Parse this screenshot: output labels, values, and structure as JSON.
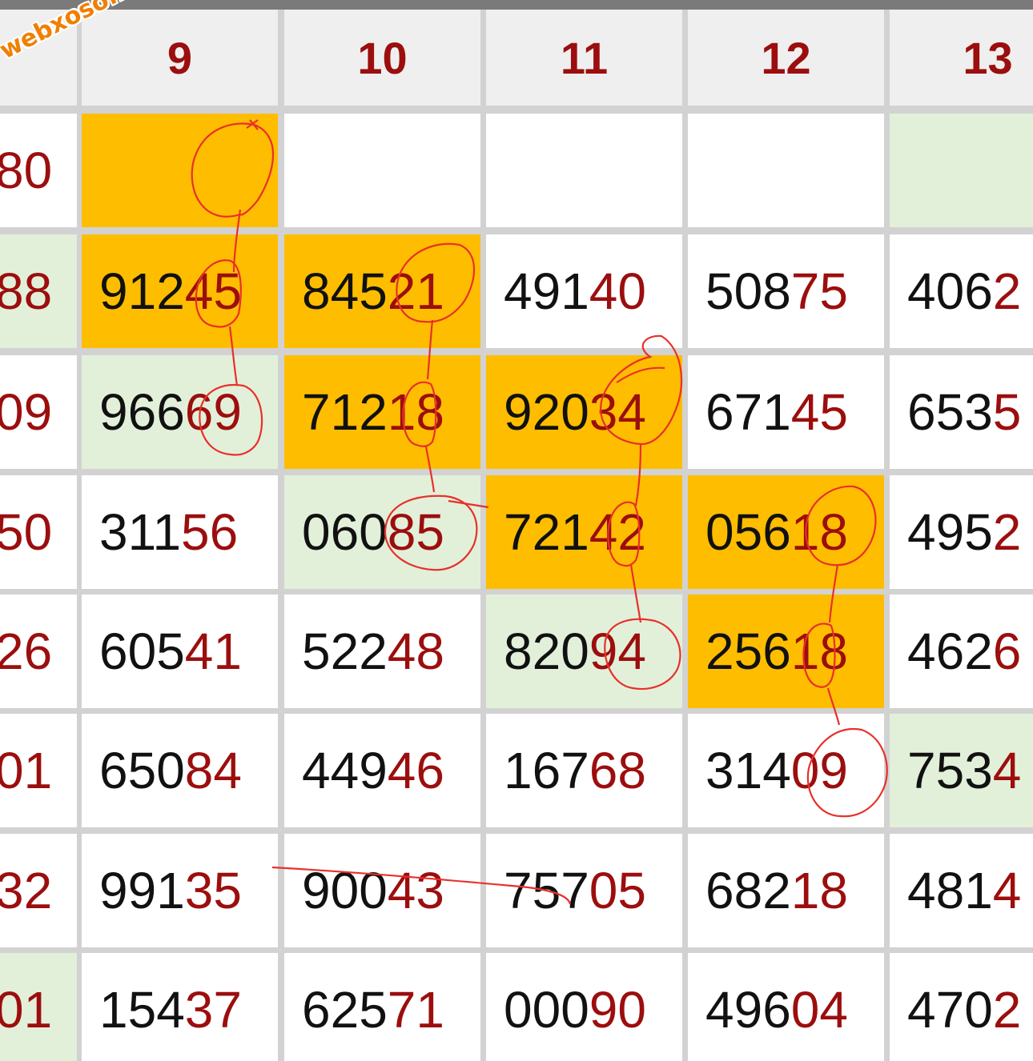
{
  "watermark": "webxoso.net",
  "columns": [
    "9",
    "10",
    "11",
    "12",
    "13"
  ],
  "rows": [
    {
      "label": "80",
      "cells": [
        {
          "digits": "",
          "tail": ""
        },
        {
          "digits": "",
          "tail": ""
        },
        {
          "digits": "",
          "tail": ""
        },
        {
          "digits": "",
          "tail": ""
        },
        {
          "digits": "",
          "tail": ""
        }
      ]
    },
    {
      "label": "88",
      "cells": [
        {
          "digits": "912",
          "tail": "45"
        },
        {
          "digits": "845",
          "tail": "21"
        },
        {
          "digits": "491",
          "tail": "40"
        },
        {
          "digits": "508",
          "tail": "75"
        },
        {
          "digits": "406",
          "tail": "2"
        }
      ]
    },
    {
      "label": "09",
      "cells": [
        {
          "digits": "966",
          "tail": "69"
        },
        {
          "digits": "712",
          "tail": "18"
        },
        {
          "digits": "920",
          "tail": "34"
        },
        {
          "digits": "671",
          "tail": "45"
        },
        {
          "digits": "653",
          "tail": "5"
        }
      ]
    },
    {
      "label": "50",
      "cells": [
        {
          "digits": "311",
          "tail": "56"
        },
        {
          "digits": "060",
          "tail": "85"
        },
        {
          "digits": "721",
          "tail": "42"
        },
        {
          "digits": "056",
          "tail": "18"
        },
        {
          "digits": "495",
          "tail": "2"
        }
      ]
    },
    {
      "label": "26",
      "cells": [
        {
          "digits": "605",
          "tail": "41"
        },
        {
          "digits": "522",
          "tail": "48"
        },
        {
          "digits": "820",
          "tail": "94"
        },
        {
          "digits": "256",
          "tail": "18"
        },
        {
          "digits": "462",
          "tail": "6"
        }
      ]
    },
    {
      "label": "01",
      "cells": [
        {
          "digits": "650",
          "tail": "84"
        },
        {
          "digits": "449",
          "tail": "46"
        },
        {
          "digits": "167",
          "tail": "68"
        },
        {
          "digits": "314",
          "tail": "09"
        },
        {
          "digits": "753",
          "tail": "4"
        }
      ]
    },
    {
      "label": "32",
      "cells": [
        {
          "digits": "991",
          "tail": "35"
        },
        {
          "digits": "900",
          "tail": "43"
        },
        {
          "digits": "757",
          "tail": "05"
        },
        {
          "digits": "682",
          "tail": "18"
        },
        {
          "digits": "481",
          "tail": "4"
        }
      ]
    },
    {
      "label": "01",
      "cells": [
        {
          "digits": "154",
          "tail": "37"
        },
        {
          "digits": "625",
          "tail": "71"
        },
        {
          "digits": "000",
          "tail": "90"
        },
        {
          "digits": "496",
          "tail": "04"
        },
        {
          "digits": "470",
          "tail": "2"
        }
      ]
    }
  ],
  "colors": {
    "highlight_orange": "#ffbd00",
    "highlight_green": "#e2f0da",
    "tail_red": "#9c0e0e",
    "annotation_red": "#e8302a"
  }
}
